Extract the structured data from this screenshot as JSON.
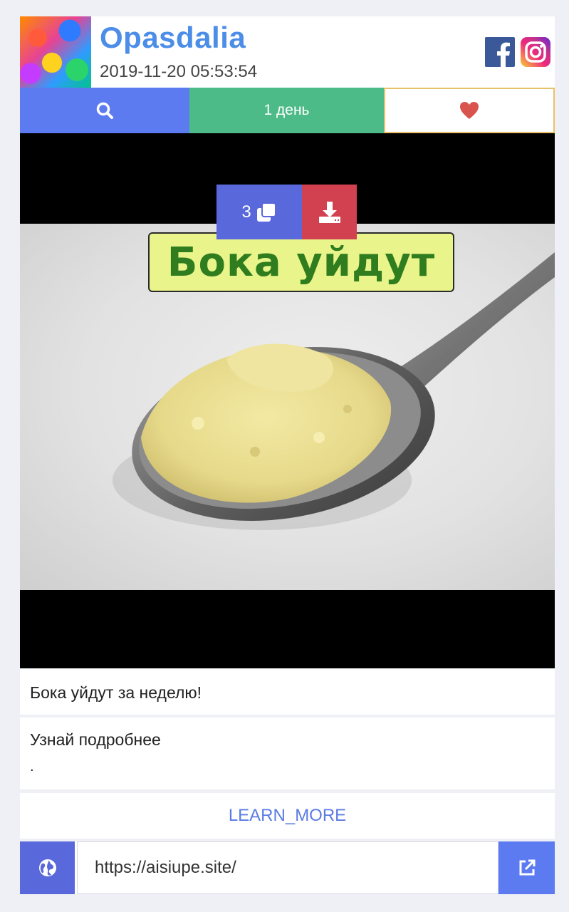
{
  "header": {
    "title": "Opasdalia",
    "timestamp": "2019-11-20 05:53:54",
    "social": [
      "facebook-icon",
      "instagram-icon"
    ]
  },
  "actions": {
    "search_icon": "search-icon",
    "days_label": "1 день",
    "like_icon": "heart-icon"
  },
  "media": {
    "count": "3",
    "count_icon": "copy-icon",
    "download_icon": "download-icon",
    "headline": "Бока уйдут"
  },
  "post": {
    "caption": "Бока уйдут за неделю!",
    "description": "Узнай подробнее",
    "description_extra": ".",
    "cta_label": "LEARN_MORE"
  },
  "link": {
    "url": "https://aisiupe.site/",
    "globe_icon": "globe-icon",
    "open_icon": "external-link-icon"
  },
  "colors": {
    "title": "#4c8de8",
    "search": "#5d7bf1",
    "days": "#4dbb88",
    "like_border": "#e9c06a",
    "heart": "#d9534f",
    "count_button": "#5968db",
    "download_button": "#d14150",
    "cta": "#5b7be3"
  }
}
